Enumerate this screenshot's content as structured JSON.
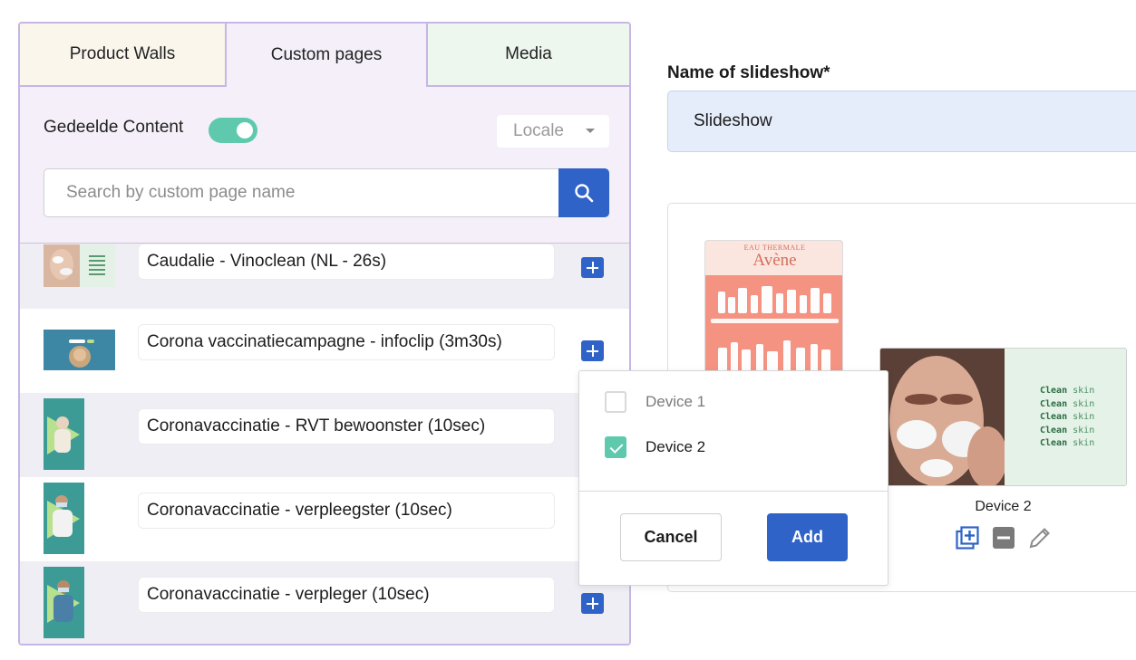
{
  "tabs": [
    {
      "label": "Product Walls"
    },
    {
      "label": "Custom pages"
    },
    {
      "label": "Media"
    }
  ],
  "filters": {
    "shared_label": "Gedeelde Content",
    "shared_toggle_on": true,
    "locale_placeholder": "Locale",
    "search_placeholder": "Search by custom page name"
  },
  "pages": [
    {
      "name": "Caudalie - Vinoclean (NL - 26s)"
    },
    {
      "name": "Corona vaccinatiecampagne - infoclip (3m30s)"
    },
    {
      "name": "Coronavaccinatie - RVT bewoonster (10sec)"
    },
    {
      "name": "Coronavaccinatie - verpleegster (10sec)"
    },
    {
      "name": "Coronavaccinatie - verpleger (10sec)"
    }
  ],
  "form": {
    "name_label": "Name of slideshow*",
    "name_value": "Slideshow"
  },
  "preview": {
    "avene_sub": "EAU THERMALE",
    "avene_brand": "Avène",
    "clean_bold": "Clean",
    "clean_light": "skin",
    "device_caption": "Device 2"
  },
  "popover": {
    "options": [
      {
        "label": "Device 1",
        "checked": false
      },
      {
        "label": "Device 2",
        "checked": true
      }
    ],
    "cancel_label": "Cancel",
    "add_label": "Add"
  },
  "colors": {
    "accent_blue": "#2f63c8",
    "toggle_green": "#5ec9ad",
    "panel_border": "#c6b6e6"
  }
}
